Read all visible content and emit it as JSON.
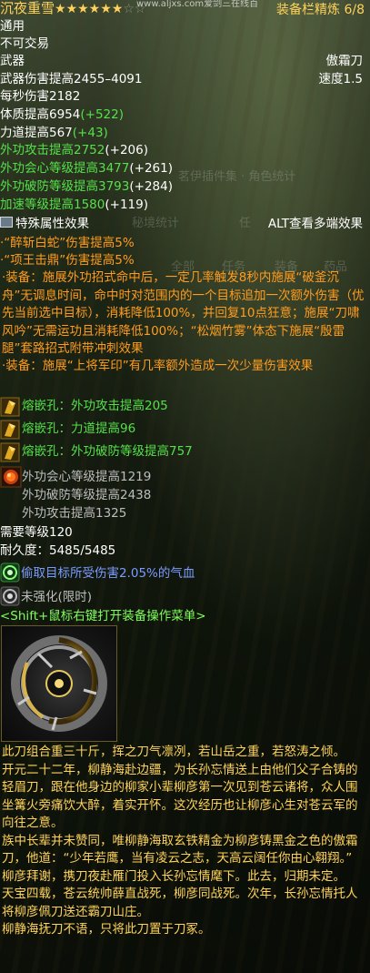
{
  "header": {
    "item_name": "沉夜重雪",
    "stars_filled": "★★★★★★",
    "stars_empty": "☆☆",
    "watermark": "www.aljxs.com爱剑三在线百",
    "slot_label": "装备栏精炼 6/8"
  },
  "basic": {
    "type": "通用",
    "trade": "不可交易",
    "category": "武器",
    "weapon_name": "傲霜刀",
    "damage": "武器伤害提高2455–4091",
    "speed": "速度1.5",
    "dps": "每秒伤害2182"
  },
  "attributes": [
    {
      "label": "体质提高6954",
      "bonus": "(+522)"
    },
    {
      "label": "力道提高567",
      "bonus": "(+43)"
    },
    {
      "label": "外功攻击提高2752",
      "bonus": "(+206)"
    },
    {
      "label": "外功会心等级提高3477",
      "bonus": "(+261)"
    },
    {
      "label": "外功破防等级提高3793",
      "bonus": "(+284)"
    },
    {
      "label": "加速等级提高1580",
      "bonus": "(+119)"
    }
  ],
  "ghost_overlay": {
    "stats_title": "茗伊插件集 · 角色统计",
    "secret_stats": "秘境统计",
    "tab_char": "任",
    "tabs": [
      "全部",
      "任务",
      "装备",
      "药品"
    ]
  },
  "special": {
    "title": "特殊属性效果",
    "alt_hint": "ALT查看多端效果",
    "lines": [
      "·“醉斩白蛇”伤害提高5%",
      "·“项王击鼎”伤害提高5%"
    ],
    "set_effect_1": "·装备：施展外功招式命中后，一定几率触发8秒内施展“破釜沉舟”无调息时间，命中时对范围内的一个目标追加一次额外伤害（优先当前选中目标），消耗降低100%，并回复10点狂意；施展“刀啸风吟”无需运功且消耗降低100%；“松烟竹雾”体态下施展“殷雷腿”套路招式附带冲刺效果",
    "set_effect_2": "·装备：施展“上将军印”有几率额外造成一次少量伤害效果"
  },
  "gems": [
    {
      "text": "熔嵌孔：外功攻击提高205"
    },
    {
      "text": "熔嵌孔：力道提高96"
    },
    {
      "text": "熔嵌孔：外功破防等级提高757"
    }
  ],
  "inlay": {
    "lines": [
      "外功会心等级提高1219",
      "外功破防等级提高2438",
      "外功攻击提高1325"
    ]
  },
  "requirements": {
    "level": "需要等级120",
    "durability": "耐久度：5485/5485"
  },
  "enchant": {
    "effect": "偷取目标所受伤害2.05%的气血",
    "unenhanced": "未强化(限时)"
  },
  "hint": "<Shift+鼠标右键打开装备操作菜单>",
  "description": [
    "此刀组合重三十斤，挥之刀气凛冽，若山岳之重，若怒涛之倾。",
    "开元二十二年，柳静海赴边疆，为长孙忘情送上由他们父子合铸的轻眉刀，跟在他身边的柳家小辈柳彦第一次见到苍云诸将，众人围坐篝火旁痛饮大醉，着实开怀。这次经历也让柳彦心生对苍云军的向往之意。",
    "族中长辈并未赞同，唯柳静海取玄铁精金为柳彦铸黑金之色的傲霜刀，他道：“少年若鹰，当有凌云之志，天高云阔任你由心翱翔。”",
    "柳彦拜谢，携刀夜赴雁门投入长孙忘情麾下。此去，归期未定。",
    "天宝四载，苍云统帅薛直战死，柳彦同战死。次年，长孙忘情托人将柳彦佩刀送还霸刀山庄。",
    "柳静海抚刀不语，只将此刀置于刀冢。"
  ],
  "colors": {
    "gold": "#ffd35a",
    "green": "#55e04a",
    "orange": "#ff9c1e",
    "blue": "#7b9cff"
  }
}
